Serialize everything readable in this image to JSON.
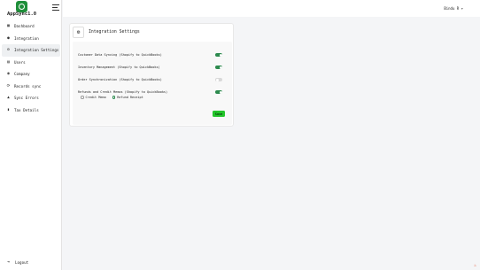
{
  "app": {
    "title": "AppSync1.0"
  },
  "sidebar": {
    "items": [
      {
        "label": "Dashboard",
        "icon": "grid-icon"
      },
      {
        "label": "Integration",
        "icon": "pin-icon"
      },
      {
        "label": "Integration Settings",
        "icon": "gear-icon"
      },
      {
        "label": "Users",
        "icon": "users-icon"
      },
      {
        "label": "Company",
        "icon": "person-icon"
      },
      {
        "label": "Records sync",
        "icon": "sync-icon"
      },
      {
        "label": "Sync Errors",
        "icon": "warning-icon"
      },
      {
        "label": "Tax Details",
        "icon": "document-icon"
      }
    ],
    "logout_label": "Logout"
  },
  "header": {
    "user_name": "Bindu R"
  },
  "settings": {
    "title": "Integration Settings",
    "options": [
      {
        "label": "Customer Data Syncing (Shopify to QuickBooks)",
        "enabled": true
      },
      {
        "label": "Inventory Management (Shopify to QuickBooks)",
        "enabled": true
      },
      {
        "label": "Order Synchronization (Shopify to QuickBooks)",
        "enabled": false
      },
      {
        "label": "Refunds and Credit Memos (Shopify to QuickBooks)",
        "enabled": true
      }
    ],
    "refund_type": {
      "options": [
        "Credit Memo",
        "Refund Receipt"
      ],
      "selected": "Refund Receipt"
    },
    "save_label": "Save"
  },
  "colors": {
    "accent": "#2d8a4e",
    "save_button": "#22c52a",
    "toggle_off": "#d9d9d9"
  }
}
